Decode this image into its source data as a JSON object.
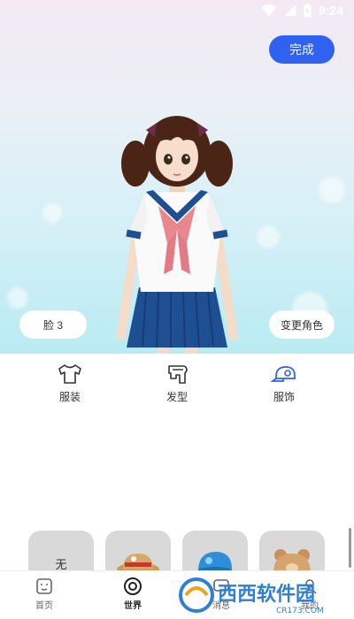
{
  "status_bar": {
    "time": "9:24",
    "icons": [
      "wifi-icon",
      "signal-icon",
      "battery-charging-icon"
    ]
  },
  "header": {
    "done_label": "完成"
  },
  "stage": {
    "face_label": "脸 3",
    "change_role_label": "变更角色"
  },
  "tabs": [
    {
      "label": "服装",
      "icon": "shirt-icon",
      "active": false
    },
    {
      "label": "发型",
      "icon": "hair-icon",
      "active": false
    },
    {
      "label": "服饰",
      "icon": "cap-icon",
      "active": true
    }
  ],
  "items": [
    {
      "label": "无",
      "icon": "none"
    },
    {
      "label": "",
      "icon": "straw-hat-icon"
    },
    {
      "label": "",
      "icon": "blue-cap-icon"
    },
    {
      "label": "",
      "icon": "bear-hat-icon"
    }
  ],
  "bottom_nav": [
    {
      "label": "首页",
      "icon": "home-icon",
      "active": false
    },
    {
      "label": "世界",
      "icon": "world-icon",
      "active": true
    },
    {
      "label": "消息",
      "icon": "message-icon",
      "active": false
    },
    {
      "label": "我的",
      "icon": "profile-icon",
      "active": false
    }
  ],
  "watermark": {
    "text": "西西软件园",
    "subtext": "CR173.COM"
  },
  "colors": {
    "accent": "#2f62f0",
    "uniform_blue": "#1f4f93",
    "scarf": "#e9878f"
  }
}
